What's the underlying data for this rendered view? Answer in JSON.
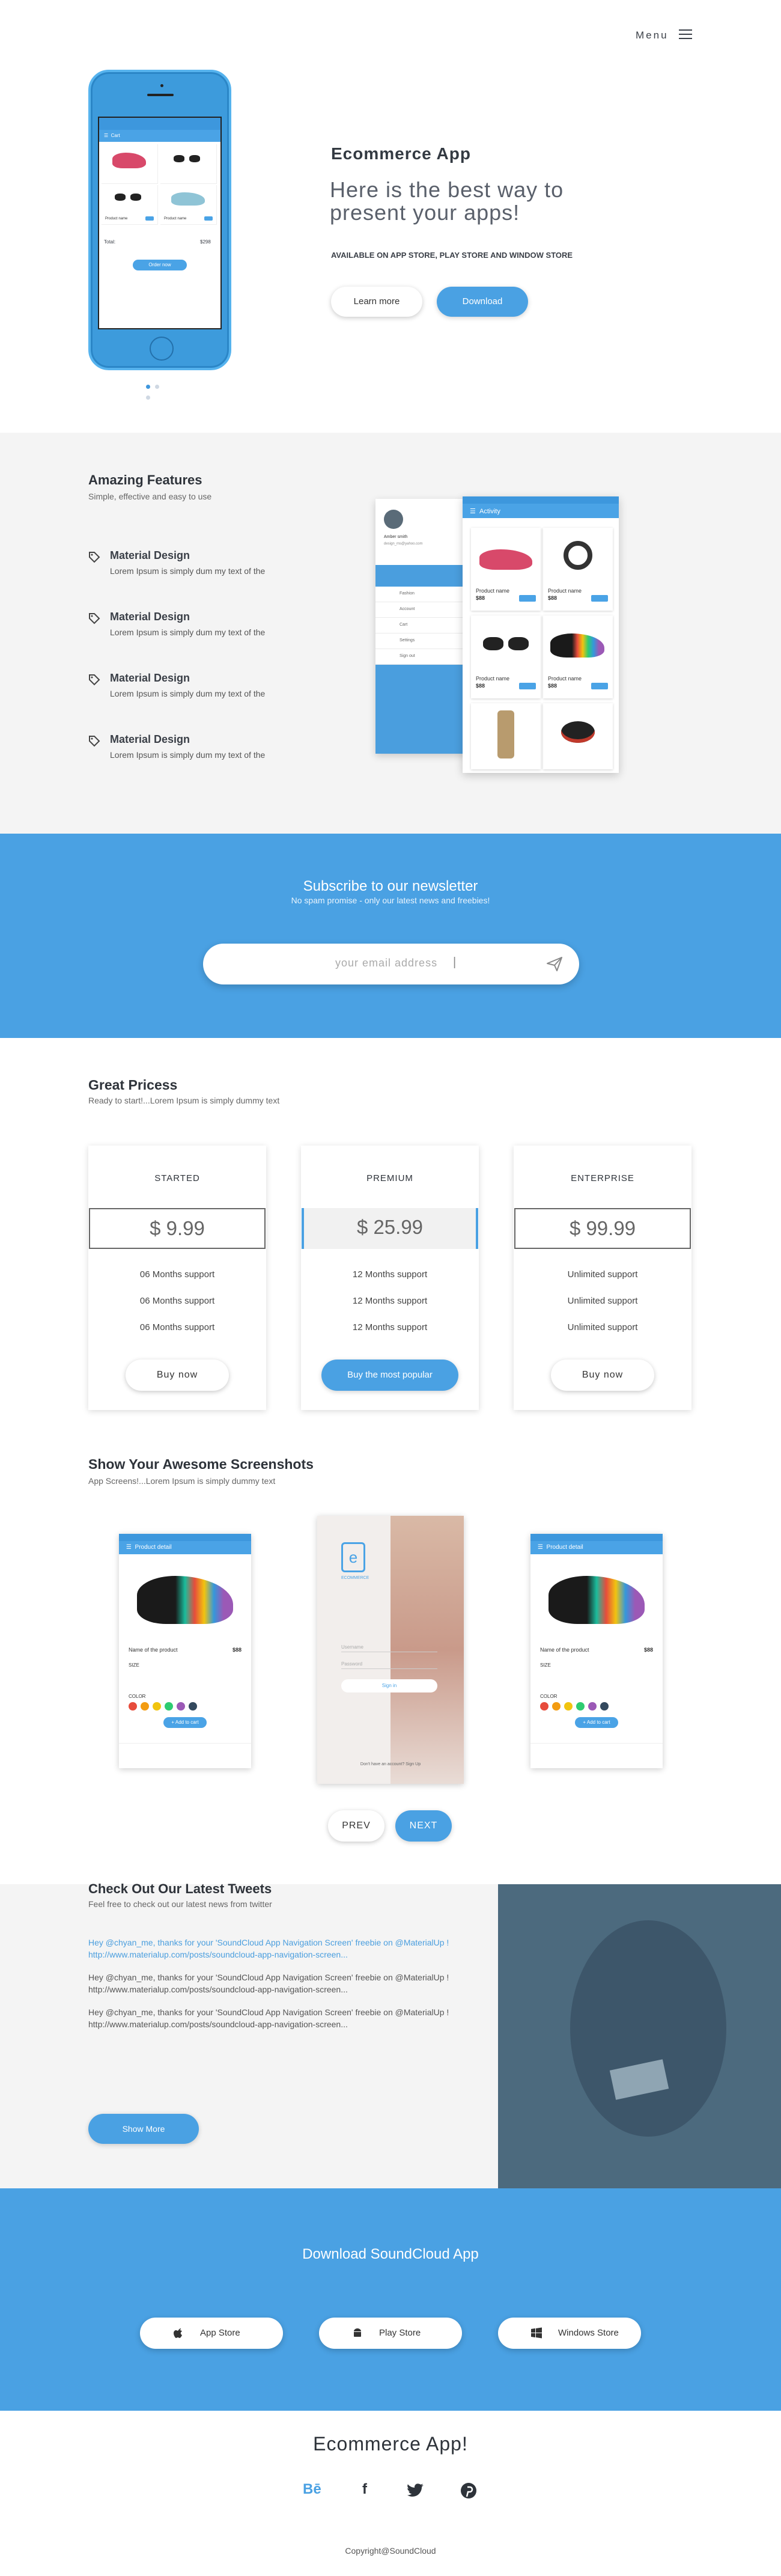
{
  "nav": {
    "menu_label": "Menu"
  },
  "hero": {
    "phone_header": "Cart",
    "phone_items": [
      {
        "name": "Product name",
        "price": "$88"
      },
      {
        "name": "Product name",
        "price": "$88"
      }
    ],
    "phone_total_label": "Total:",
    "phone_total_value": "$298",
    "phone_button": "Order now",
    "title": "Ecommerce App",
    "subtitle": "Here is the best way to present your apps!",
    "availability": "AVAILABLE ON APP STORE, PLAY STORE AND WINDOW STORE",
    "learn_more": "Learn more",
    "download": "Download"
  },
  "features": {
    "title": "Amazing Features",
    "subtitle": "Simple, effective and easy to use",
    "items": [
      {
        "title": "Material Design",
        "text": "Lorem Ipsum is simply dum my text of the"
      },
      {
        "title": "Material Design",
        "text": "Lorem Ipsum is simply dum my text of the"
      },
      {
        "title": "Material Design",
        "text": "Lorem Ipsum is simply dum my text of the"
      },
      {
        "title": "Material Design",
        "text": "Lorem Ipsum is simply dum my text of the"
      }
    ],
    "activity_title": "Activity",
    "drawer_user": "Amber smith",
    "drawer_email": "design_ms@yahoo.com",
    "drawer_items": [
      "Fashion",
      "Account",
      "Cart",
      "Settings",
      "Sign out"
    ],
    "activity_products": [
      {
        "name": "Product name",
        "price": "$88"
      },
      {
        "name": "Product name",
        "price": "$88"
      },
      {
        "name": "Product name",
        "price": "$88"
      },
      {
        "name": "Product name",
        "price": "$88"
      }
    ]
  },
  "newsletter": {
    "title": "Subscribe to our newsletter",
    "subtitle": "No spam promise - only our latest news and freebies!",
    "placeholder": "your email address"
  },
  "pricing": {
    "title": "Great Pricess",
    "subtitle": "Ready to start!...Lorem Ipsum is simply dummy text",
    "plans": [
      {
        "name": "STARTED",
        "price": "$ 9.99",
        "features": [
          "06 Months support",
          "06 Months support",
          "06 Months support"
        ],
        "button": "Buy now"
      },
      {
        "name": "PREMIUM",
        "price": "$ 25.99",
        "features": [
          "12 Months support",
          "12 Months support",
          "12 Months support"
        ],
        "button": "Buy the most popular"
      },
      {
        "name": "ENTERPRISE",
        "price": "$ 99.99",
        "features": [
          "Unlimited  support",
          "Unlimited  support",
          "Unlimited  support"
        ],
        "button": "Buy now"
      }
    ]
  },
  "screenshots": {
    "title": "Show Your Awesome Screenshots",
    "subtitle": "App Screens!...Lorem Ipsum is simply dummy text",
    "detail_header": "Product detail",
    "product_name": "Name of the product",
    "product_price": "$88",
    "size_label": "SIZE",
    "color_label": "COLOR",
    "add_to_cart": "+ Add to cart",
    "login_brand": "ECOMMERCE",
    "login_username": "Username",
    "login_password": "Password",
    "login_button": "Sign in",
    "login_footer": "Don't have an account? Sign Up",
    "prev": "PREV",
    "next": "NEXT",
    "colors": [
      "#e74c3c",
      "#f39c12",
      "#f1c40f",
      "#2ecc71",
      "#9b59b6",
      "#34495e"
    ]
  },
  "tweets": {
    "title": "Check Out Our Latest Tweets",
    "subtitle": "Feel free to check out our latest news from twitter",
    "items": [
      "Hey @chyan_me, thanks for your 'SoundCloud App Navigation Screen' freebie on @MaterialUp ! http://www.materialup.com/posts/soundcloud-app-navigation-screen...",
      "Hey @chyan_me, thanks for your 'SoundCloud App Navigation Screen' freebie on @MaterialUp ! http://www.materialup.com/posts/soundcloud-app-navigation-screen...",
      "Hey @chyan_me, thanks for your 'SoundCloud App Navigation Screen' freebie on @MaterialUp ! http://www.materialup.com/posts/soundcloud-app-navigation-screen..."
    ],
    "show_more": "Show More"
  },
  "download": {
    "title": "Download SoundCloud App",
    "stores": [
      "App Store",
      "Play Store",
      "Windows Store"
    ]
  },
  "footer": {
    "title": "Ecommerce App!",
    "social": [
      "Bē",
      "f",
      "t",
      "p"
    ],
    "copyright": "Copyright@SoundCloud"
  },
  "colors": {
    "accent": "#4aa1e3",
    "gray_bg": "#f4f4f4",
    "text": "#2e333a"
  }
}
